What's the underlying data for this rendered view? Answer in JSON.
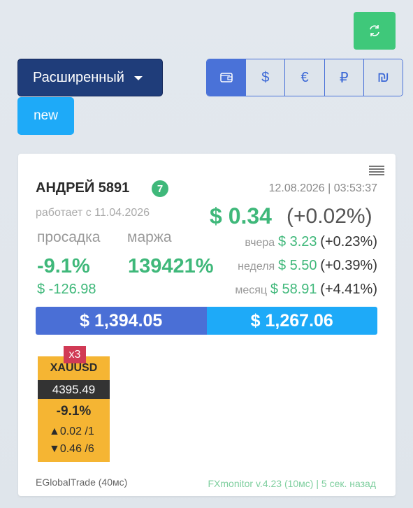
{
  "toolbar": {
    "refresh_icon": "refresh-icon",
    "mode_label": "Расширенный",
    "new_label": "new",
    "currencies": [
      "wallet",
      "$",
      "€",
      "₽",
      "₪"
    ]
  },
  "colors": {
    "green": "#3fb87a",
    "blue_dark": "#1f3d7a",
    "blue": "#4a72d8",
    "cyan": "#1eaaf8",
    "tile": "#f5b533",
    "badge_red": "#d13a55"
  },
  "account": {
    "name": "АНДРЕЙ 5891",
    "count": "7",
    "datetime": "12.08.2026 | 03:53:37",
    "since": "работает с 11.04.2026",
    "change_value": "$ 0.34",
    "change_pct": "(+0.02%)",
    "drawdown_label": "просадка",
    "margin_label": "маржа",
    "drawdown_pct": "-9.1%",
    "margin_value": "139421%",
    "drawdown_abs": "$ -126.98",
    "periods": {
      "yesterday": {
        "label": "вчера",
        "value": "$ 3.23",
        "pct": "(+0.23%)"
      },
      "week": {
        "label": "неделя",
        "value": "$ 5.50",
        "pct": "(+0.39%)"
      },
      "month": {
        "label": "месяц",
        "value": "$ 58.91",
        "pct": "(+4.41%)"
      }
    },
    "balance": "$ 1,394.05",
    "equity": "$ 1,267.06"
  },
  "instrument": {
    "multiplier": "x3",
    "symbol": "XAUUSD",
    "price": "4395.49",
    "pct": "-9.1%",
    "up": "▲0.02 /1",
    "down": "▼0.46 /6"
  },
  "footer": {
    "broker": "EGlobalTrade (40мс)",
    "version": "FXmonitor v.4.23 (10мс) | 5 сек. назад"
  }
}
